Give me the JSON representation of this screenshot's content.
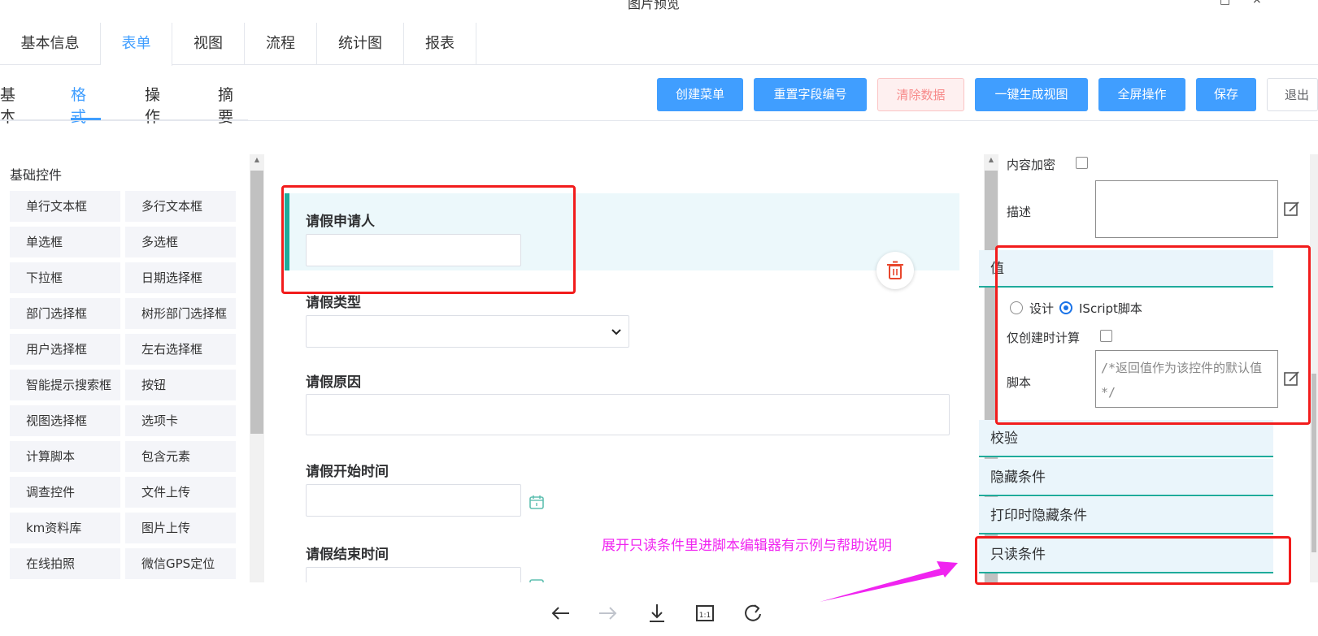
{
  "window": {
    "title": "图片预览"
  },
  "top_tabs": [
    "基本信息",
    "表单",
    "视图",
    "流程",
    "统计图",
    "报表"
  ],
  "sub_tabs": [
    "基本",
    "格式",
    "操作",
    "摘要"
  ],
  "toolbar": {
    "create_menu": "创建菜单",
    "reset_field_numbers": "重置字段编号",
    "clear_data": "清除数据",
    "generate_view": "一键生成视图",
    "fullscreen": "全屏操作",
    "save": "保存",
    "exit": "退出"
  },
  "palette": {
    "title": "基础控件",
    "items": [
      "单行文本框",
      "多行文本框",
      "单选框",
      "多选框",
      "下拉框",
      "日期选择框",
      "部门选择框",
      "树形部门选择框",
      "用户选择框",
      "左右选择框",
      "智能提示搜索框",
      "按钮",
      "视图选择框",
      "选项卡",
      "计算脚本",
      "包含元素",
      "调查控件",
      "文件上传",
      "km资料库",
      "图片上传",
      "在线拍照",
      "微信GPS定位"
    ]
  },
  "form": {
    "fields": [
      {
        "label": "请假申请人"
      },
      {
        "label": "请假类型"
      },
      {
        "label": "请假原因"
      },
      {
        "label": "请假开始时间"
      },
      {
        "label": "请假结束时间"
      }
    ]
  },
  "props": {
    "encrypt_label": "内容加密",
    "desc_label": "描述",
    "value_section": "值",
    "radio_design": "设计",
    "radio_script": "IScript脚本",
    "calc_on_create": "仅创建时计算",
    "script_label": "脚本",
    "script_placeholder": "/*返回值作为该控件的默认值 */",
    "sections": [
      "校验",
      "隐藏条件",
      "打印时隐藏条件",
      "只读条件"
    ]
  },
  "annotation": "展开只读条件里进脚本编辑器有示例与帮助说明",
  "colors": {
    "primary": "#409eff",
    "accent_teal": "#1fab9b",
    "annotation_red": "#f21c1c",
    "annotation_magenta": "#f024f0"
  }
}
